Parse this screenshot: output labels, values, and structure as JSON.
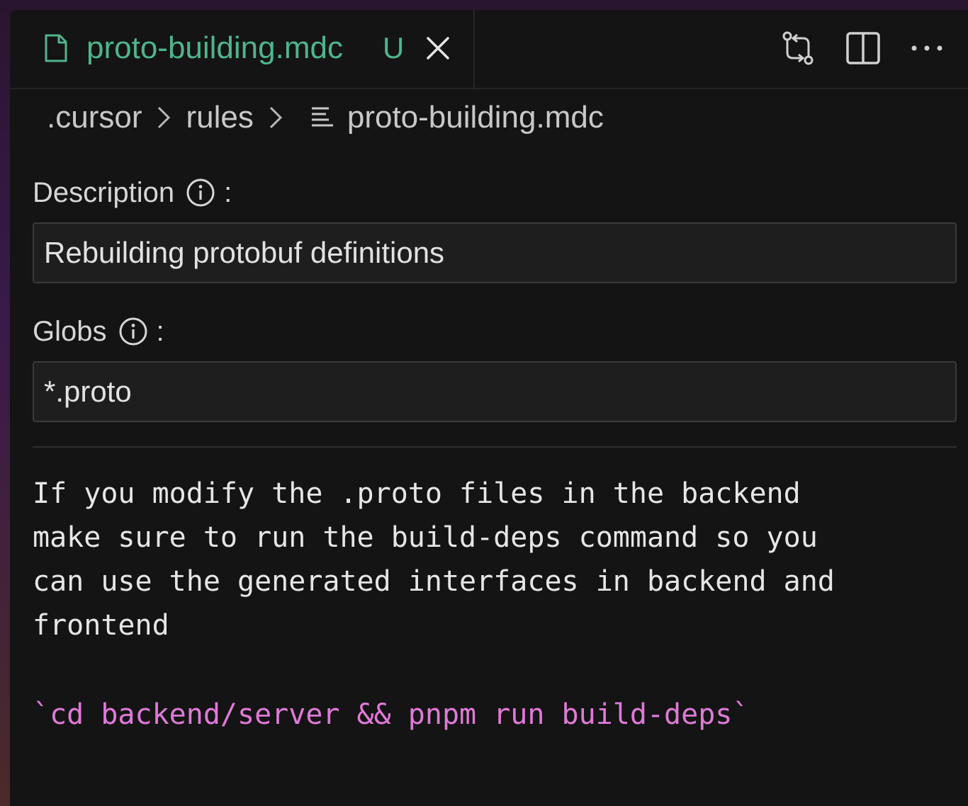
{
  "tab": {
    "title": "proto-building.mdc",
    "status": "U",
    "file_icon": "file-icon",
    "close_icon": "close-icon"
  },
  "toolbar": {
    "icons": [
      "git-compare-icon",
      "split-editor-icon",
      "more-actions-icon"
    ]
  },
  "breadcrumb": {
    "items": [
      ".cursor",
      "rules",
      "proto-building.mdc"
    ],
    "file_icon": "list-file-icon"
  },
  "description": {
    "label": "Description",
    "suffix": ":",
    "value": "Rebuilding protobuf definitions"
  },
  "globs": {
    "label": "Globs",
    "suffix": ":",
    "value": "*.proto"
  },
  "content": {
    "lines": [
      "If you modify the .proto files in the backend",
      "make sure to run the build-deps command so you",
      "can use the generated interfaces in backend and",
      "frontend"
    ],
    "code": "`cd backend/server && pnpm run build-deps`"
  },
  "colors": {
    "accent_green": "#4fb58c",
    "code_pink": "#e07ad8",
    "background": "#141414"
  }
}
